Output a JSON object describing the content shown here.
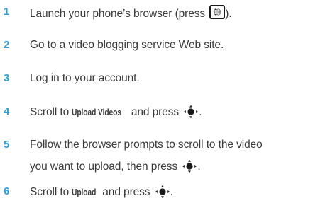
{
  "steps": [
    {
      "number": "1",
      "before": "Launch your phone’s browser (press ",
      "key_icon": "browser-key-icon",
      "after": ")."
    },
    {
      "number": "2",
      "text": "Go to a video blogging service Web site."
    },
    {
      "number": "3",
      "text": "Log in to your account."
    },
    {
      "number": "4",
      "before": "Scroll to ",
      "keyword": "Upload Videos",
      "middle": " and press ",
      "key_icon": "nav-center-key-icon",
      "after": "."
    },
    {
      "number": "5",
      "line1": "Follow the browser prompts to scroll to the video",
      "line2_before": "you want to upload, then press ",
      "key_icon": "nav-center-key-icon",
      "after": "."
    },
    {
      "number": "6",
      "before": "Scroll to ",
      "keyword": "Upload",
      "middle": " and press ",
      "key_icon": "nav-center-key-icon",
      "after": "."
    }
  ],
  "colors": {
    "step_number": "#2f9fd8",
    "body_text": "#3a3a3a",
    "icon": "#1a1a1a"
  }
}
